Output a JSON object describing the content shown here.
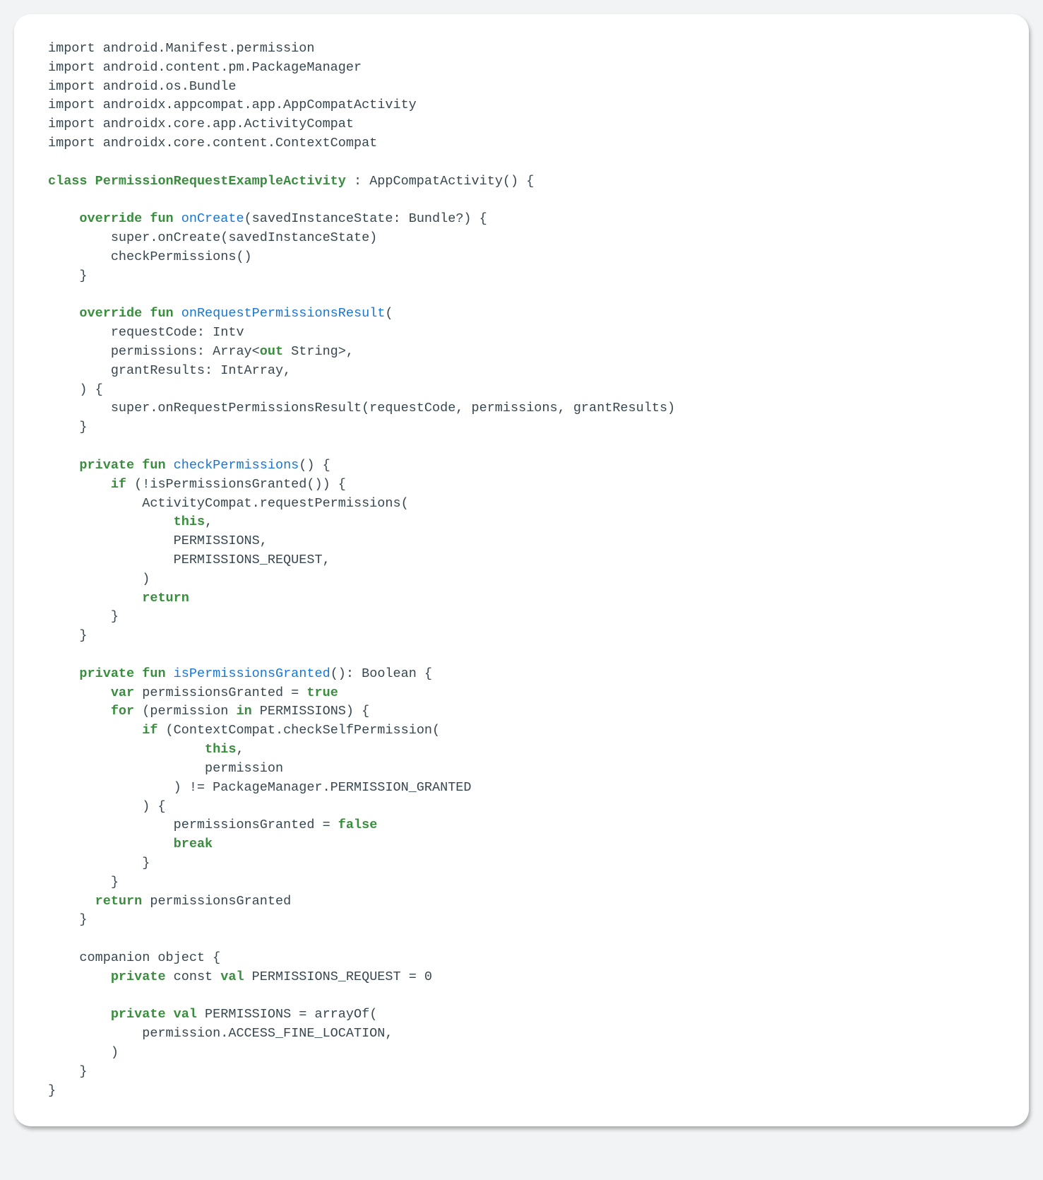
{
  "code": {
    "tokens": [
      {
        "t": "import android.Manifest.permission\n",
        "c": ""
      },
      {
        "t": "import android.content.pm.PackageManager\n",
        "c": ""
      },
      {
        "t": "import android.os.Bundle\n",
        "c": ""
      },
      {
        "t": "import androidx.appcompat.app.AppCompatActivity\n",
        "c": ""
      },
      {
        "t": "import androidx.core.app.ActivityCompat\n",
        "c": ""
      },
      {
        "t": "import androidx.core.content.ContextCompat\n",
        "c": ""
      },
      {
        "t": "\n",
        "c": ""
      },
      {
        "t": "class ",
        "c": "kw"
      },
      {
        "t": "PermissionRequestExampleActivity",
        "c": "cls"
      },
      {
        "t": " : AppCompatActivity() {\n",
        "c": ""
      },
      {
        "t": "\n",
        "c": ""
      },
      {
        "t": "    ",
        "c": ""
      },
      {
        "t": "override fun ",
        "c": "kw"
      },
      {
        "t": "onCreate",
        "c": "fn"
      },
      {
        "t": "(savedInstanceState: Bundle?) {\n",
        "c": ""
      },
      {
        "t": "        super.onCreate(savedInstanceState)\n",
        "c": ""
      },
      {
        "t": "        checkPermissions()\n",
        "c": ""
      },
      {
        "t": "    }\n",
        "c": ""
      },
      {
        "t": "\n",
        "c": ""
      },
      {
        "t": "    ",
        "c": ""
      },
      {
        "t": "override fun ",
        "c": "kw"
      },
      {
        "t": "onRequestPermissionsResult",
        "c": "fn"
      },
      {
        "t": "(\n",
        "c": ""
      },
      {
        "t": "        requestCode: Intv\n",
        "c": ""
      },
      {
        "t": "        permissions: Array<",
        "c": ""
      },
      {
        "t": "out",
        "c": "kw"
      },
      {
        "t": " String>,\n",
        "c": ""
      },
      {
        "t": "        grantResults: IntArray,\n",
        "c": ""
      },
      {
        "t": "    ) {\n",
        "c": ""
      },
      {
        "t": "        super.onRequestPermissionsResult(requestCode, permissions, grantResults)\n",
        "c": ""
      },
      {
        "t": "    }\n",
        "c": ""
      },
      {
        "t": "\n",
        "c": ""
      },
      {
        "t": "    ",
        "c": ""
      },
      {
        "t": "private fun ",
        "c": "kw"
      },
      {
        "t": "checkPermissions",
        "c": "fn"
      },
      {
        "t": "() {\n",
        "c": ""
      },
      {
        "t": "        ",
        "c": ""
      },
      {
        "t": "if",
        "c": "kw"
      },
      {
        "t": " (!isPermissionsGranted()) {\n",
        "c": ""
      },
      {
        "t": "            ActivityCompat.requestPermissions(\n",
        "c": ""
      },
      {
        "t": "                ",
        "c": ""
      },
      {
        "t": "this",
        "c": "kw"
      },
      {
        "t": ",\n",
        "c": ""
      },
      {
        "t": "                PERMISSIONS,\n",
        "c": ""
      },
      {
        "t": "                PERMISSIONS_REQUEST,\n",
        "c": ""
      },
      {
        "t": "            )\n",
        "c": ""
      },
      {
        "t": "            ",
        "c": ""
      },
      {
        "t": "return",
        "c": "kw"
      },
      {
        "t": "\n",
        "c": ""
      },
      {
        "t": "        }\n",
        "c": ""
      },
      {
        "t": "    }\n",
        "c": ""
      },
      {
        "t": "\n",
        "c": ""
      },
      {
        "t": "    ",
        "c": ""
      },
      {
        "t": "private fun ",
        "c": "kw"
      },
      {
        "t": "isPermissionsGranted",
        "c": "fn"
      },
      {
        "t": "(): Boolean {\n",
        "c": ""
      },
      {
        "t": "        ",
        "c": ""
      },
      {
        "t": "var",
        "c": "kw"
      },
      {
        "t": " permissionsGranted = ",
        "c": ""
      },
      {
        "t": "true",
        "c": "kw"
      },
      {
        "t": "\n",
        "c": ""
      },
      {
        "t": "        ",
        "c": ""
      },
      {
        "t": "for",
        "c": "kw"
      },
      {
        "t": " (permission ",
        "c": ""
      },
      {
        "t": "in",
        "c": "kw"
      },
      {
        "t": " PERMISSIONS) {\n",
        "c": ""
      },
      {
        "t": "            ",
        "c": ""
      },
      {
        "t": "if",
        "c": "kw"
      },
      {
        "t": " (ContextCompat.checkSelfPermission(\n",
        "c": ""
      },
      {
        "t": "                    ",
        "c": ""
      },
      {
        "t": "this",
        "c": "kw"
      },
      {
        "t": ",\n",
        "c": ""
      },
      {
        "t": "                    permission\n",
        "c": ""
      },
      {
        "t": "                ) != PackageManager.PERMISSION_GRANTED\n",
        "c": ""
      },
      {
        "t": "            ) {\n",
        "c": ""
      },
      {
        "t": "                permissionsGranted = ",
        "c": ""
      },
      {
        "t": "false",
        "c": "kw"
      },
      {
        "t": "\n",
        "c": ""
      },
      {
        "t": "                ",
        "c": ""
      },
      {
        "t": "break",
        "c": "kw"
      },
      {
        "t": "\n",
        "c": ""
      },
      {
        "t": "            }\n",
        "c": ""
      },
      {
        "t": "        }\n",
        "c": ""
      },
      {
        "t": "      ",
        "c": ""
      },
      {
        "t": "return",
        "c": "kw"
      },
      {
        "t": " permissionsGranted\n",
        "c": ""
      },
      {
        "t": "    }\n",
        "c": ""
      },
      {
        "t": "\n",
        "c": ""
      },
      {
        "t": "    companion object {\n",
        "c": ""
      },
      {
        "t": "        ",
        "c": ""
      },
      {
        "t": "private",
        "c": "kw"
      },
      {
        "t": " const ",
        "c": ""
      },
      {
        "t": "val",
        "c": "kw"
      },
      {
        "t": " PERMISSIONS_REQUEST = ",
        "c": ""
      },
      {
        "t": "0",
        "c": "num"
      },
      {
        "t": "\n",
        "c": ""
      },
      {
        "t": "\n",
        "c": ""
      },
      {
        "t": "        ",
        "c": ""
      },
      {
        "t": "private val",
        "c": "kw"
      },
      {
        "t": " PERMISSIONS = arrayOf(\n",
        "c": ""
      },
      {
        "t": "            permission.ACCESS_FINE_LOCATION,\n",
        "c": ""
      },
      {
        "t": "        )\n",
        "c": ""
      },
      {
        "t": "    }\n",
        "c": ""
      },
      {
        "t": "}",
        "c": ""
      }
    ]
  }
}
